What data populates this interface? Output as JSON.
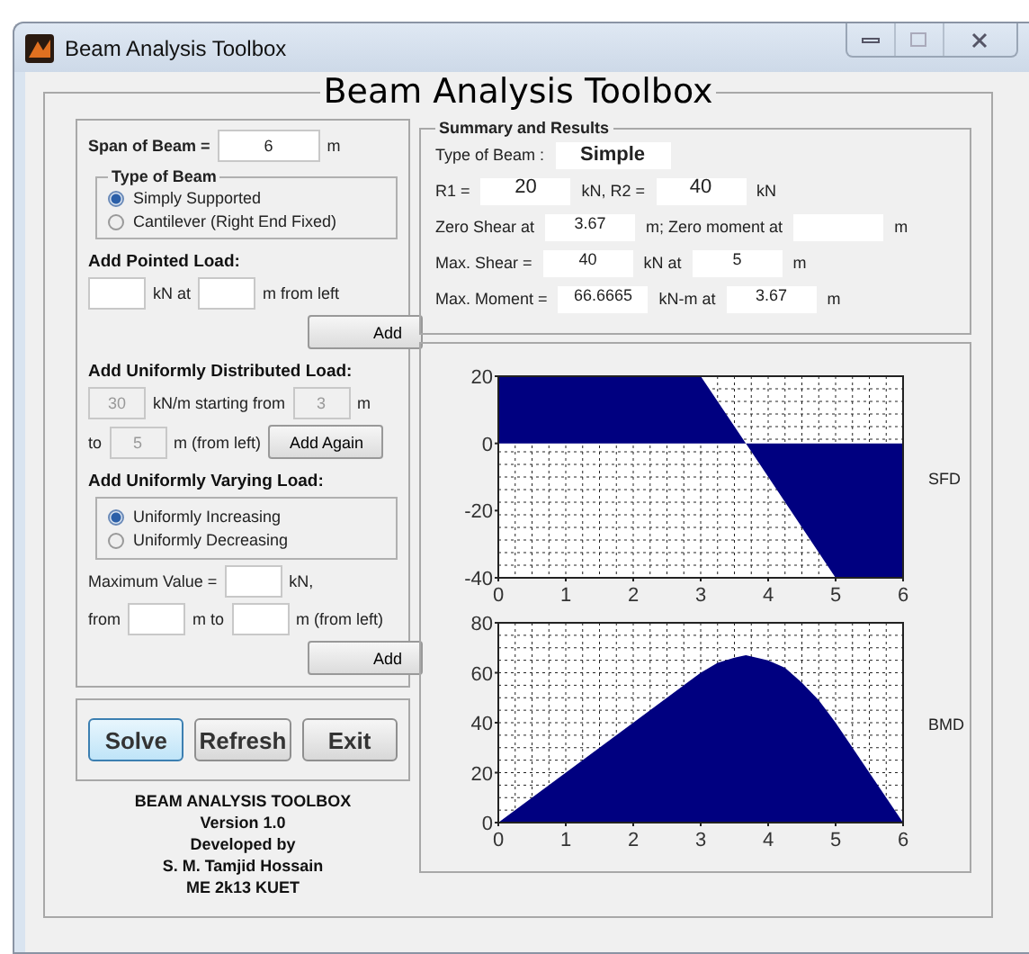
{
  "window": {
    "title": "Beam Analysis Toolbox"
  },
  "heading": "Beam Analysis Toolbox",
  "inputs": {
    "span": [
      {
        "kind": "caption",
        "text": "Span of Beam ="
      },
      {
        "kind": "field",
        "value": "6",
        "disabled": false
      },
      {
        "kind": "label",
        "text": "m"
      }
    ],
    "beam_type": {
      "title": "Type of Beam",
      "options": [
        {
          "label": "Simply Supported",
          "selected": true
        },
        {
          "label": "Cantilever  (Right End Fixed)",
          "selected": false
        }
      ]
    },
    "point_load": {
      "title": "Add Pointed Load:",
      "lines": [
        {
          "items": [
            {
              "kind": "field",
              "disabled": false
            },
            {
              "kind": "label",
              "text": "kN at"
            },
            {
              "kind": "field",
              "disabled": false
            },
            {
              "kind": "label",
              "text": "m from left"
            }
          ]
        },
        {
          "items": [
            {
              "kind": "button",
              "text": "Add"
            }
          ]
        }
      ]
    },
    "udl": {
      "title": "Add Uniformly Distributed Load:",
      "lines": [
        {
          "items": [
            {
              "kind": "field",
              "value": "30",
              "disabled": true
            },
            {
              "kind": "label",
              "text": "kN/m starting from"
            },
            {
              "kind": "field",
              "value": "3",
              "disabled": true
            },
            {
              "kind": "label",
              "text": "m"
            }
          ]
        },
        {
          "items": [
            {
              "kind": "label",
              "text": "to"
            },
            {
              "kind": "field",
              "value": "5",
              "disabled": true
            },
            {
              "kind": "label",
              "text": "m (from left)"
            },
            {
              "kind": "button",
              "text": "Add Again"
            }
          ]
        }
      ]
    },
    "uvl": {
      "title": "Add Uniformly Varying Load:",
      "options": [
        {
          "label": "Uniformly Increasing",
          "selected": true
        },
        {
          "label": "Uniformly Decreasing",
          "selected": false
        }
      ],
      "lines": [
        {
          "items": [
            {
              "kind": "label",
              "text": "Maximum Value ="
            },
            {
              "kind": "field",
              "disabled": false
            },
            {
              "kind": "label",
              "text": "kN,"
            }
          ]
        },
        {
          "items": [
            {
              "kind": "label",
              "text": "from"
            },
            {
              "kind": "field",
              "disabled": false
            },
            {
              "kind": "label",
              "text": "m to"
            },
            {
              "kind": "field",
              "disabled": false
            },
            {
              "kind": "label",
              "text": "m (from left)"
            }
          ]
        },
        {
          "items": [
            {
              "kind": "button",
              "text": "Add"
            }
          ]
        }
      ]
    }
  },
  "actions": [
    {
      "label": "Solve",
      "focused": true
    },
    {
      "label": "Refresh",
      "focused": false
    },
    {
      "label": "Exit",
      "focused": false
    }
  ],
  "credits": [
    "BEAM ANALYSIS TOOLBOX",
    "Version 1.0",
    "Developed by",
    "S. M. Tamjid Hossain",
    "ME 2k13 KUET"
  ],
  "summary": {
    "title": "Summary and Results",
    "lines": [
      {
        "items": [
          {
            "kind": "label",
            "text": "Type of Beam :"
          },
          {
            "kind": "result",
            "value": "Simple"
          }
        ]
      },
      {
        "items": [
          {
            "kind": "label",
            "text": "R1 ="
          },
          {
            "kind": "reaction",
            "value": "20"
          },
          {
            "kind": "label",
            "text": "kN,  R2 ="
          },
          {
            "kind": "reaction",
            "value": "40"
          },
          {
            "kind": "label",
            "text": "kN"
          }
        ]
      },
      {
        "items": [
          {
            "kind": "label",
            "text": "Zero Shear at"
          },
          {
            "kind": "field",
            "value": "3.67"
          },
          {
            "kind": "label",
            "text": "m;  Zero moment at"
          },
          {
            "kind": "field"
          },
          {
            "kind": "label",
            "text": "m"
          }
        ]
      },
      {
        "items": [
          {
            "kind": "label",
            "text": "Max. Shear ="
          },
          {
            "kind": "field",
            "value": "40"
          },
          {
            "kind": "label",
            "text": "kN at"
          },
          {
            "kind": "field",
            "value": "5"
          },
          {
            "kind": "label",
            "text": "m"
          }
        ]
      },
      {
        "items": [
          {
            "kind": "label",
            "text": "Max. Moment ="
          },
          {
            "kind": "field",
            "value": "66.6665"
          },
          {
            "kind": "label",
            "text": "kN-m at"
          },
          {
            "kind": "field",
            "value": "3.67"
          },
          {
            "kind": "label",
            "text": "m"
          }
        ]
      }
    ]
  },
  "charts": [
    {
      "chart_data": {
        "type": "area",
        "x": [
          0,
          3,
          3.67,
          5,
          6
        ],
        "series": [
          {
            "name": "SFD",
            "color": "#000080",
            "values": [
              20,
              20,
              0,
              -40,
              -40
            ]
          }
        ],
        "xlim": [
          0,
          6
        ],
        "ylim": [
          -40,
          20
        ],
        "xticks": [
          0,
          1,
          2,
          3,
          4,
          5,
          6
        ],
        "yticks": [
          -40,
          -20,
          0,
          20
        ],
        "grid": true
      }
    },
    {
      "chart_data": {
        "type": "area",
        "x": [
          0,
          1,
          2,
          3,
          3.25,
          3.5,
          3.67,
          4,
          4.25,
          4.5,
          4.75,
          5,
          6
        ],
        "series": [
          {
            "name": "BMD",
            "color": "#000080",
            "values": [
              0,
              20,
              40,
              60,
              64,
              66,
              67,
              65,
              62,
              56,
              49,
              40,
              0
            ]
          }
        ],
        "xlim": [
          0,
          6
        ],
        "ylim": [
          0,
          80
        ],
        "xticks": [
          0,
          1,
          2,
          3,
          4,
          5,
          6
        ],
        "yticks": [
          0,
          20,
          40,
          60,
          80
        ],
        "grid": true
      }
    }
  ]
}
